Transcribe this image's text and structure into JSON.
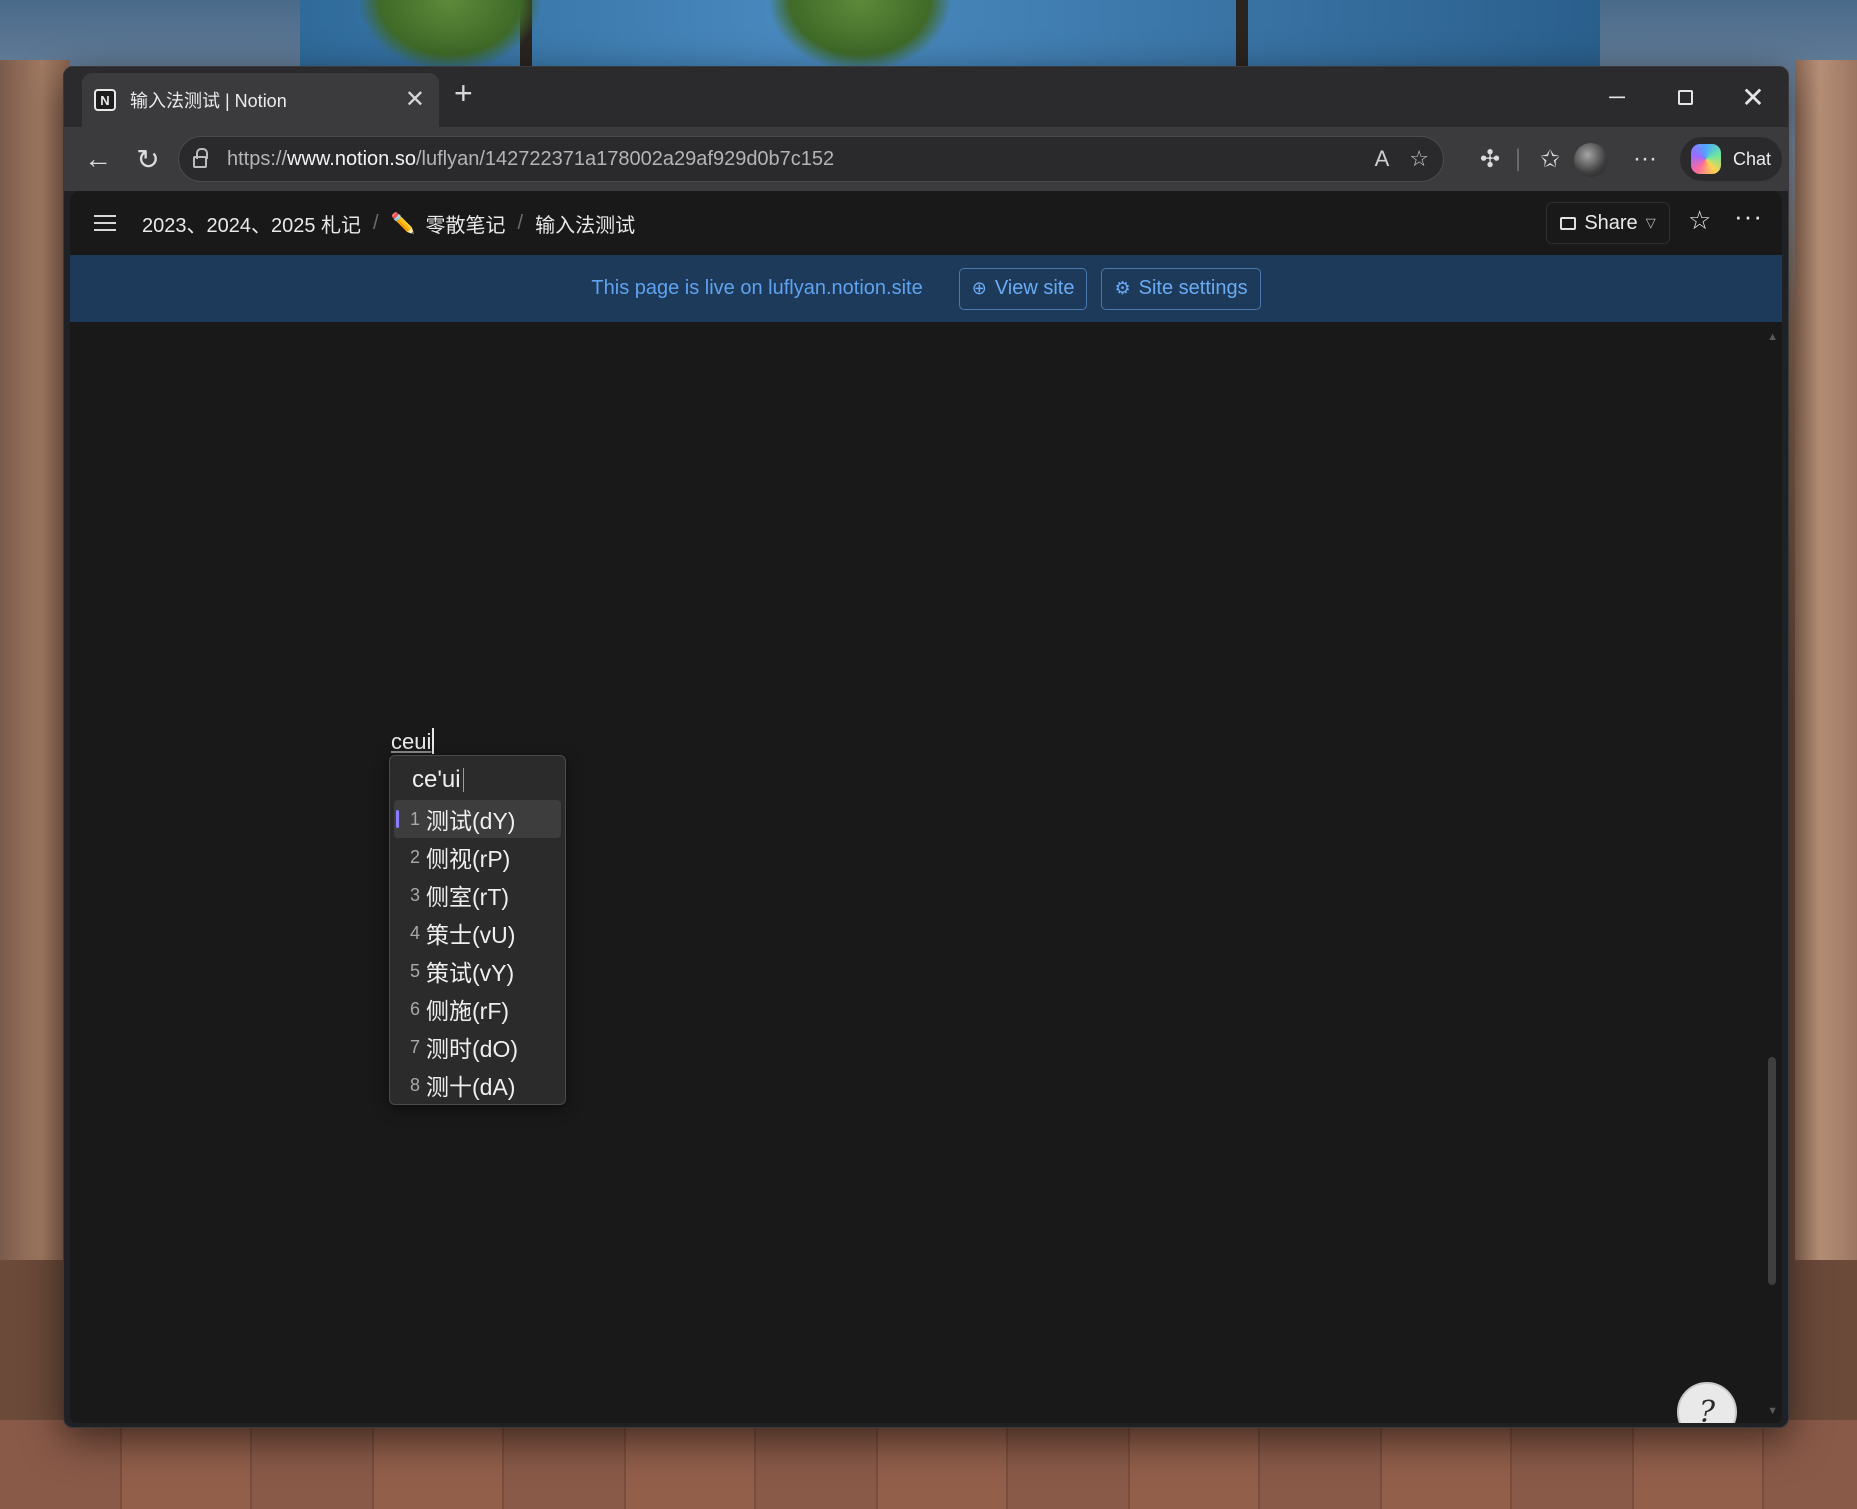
{
  "browser": {
    "tab_title": "输入法测试 | Notion",
    "tab_favicon": "N",
    "new_tab": "+",
    "url_prefix": "https://",
    "url_host": "www.notion.so",
    "url_path": "/luflyan/142722371a178002a29af929d0b7c152",
    "read_aloud": "A",
    "chat_label": "Chat"
  },
  "notion": {
    "breadcrumb": [
      "2023、2024、2025 札记",
      "零散笔记",
      "输入法测试"
    ],
    "breadcrumb_separator": "/",
    "pencil_emoji": "✏️",
    "share_label": "Share",
    "banner_text": "This page is live on luflyan.notion.site",
    "view_site_label": "View site",
    "site_settings_label": "Site settings",
    "typed_text": "ceui"
  },
  "ime": {
    "composition": "ce'ui",
    "candidates": [
      {
        "num": "1",
        "word": "测试(dY)"
      },
      {
        "num": "2",
        "word": "侧视(rP)"
      },
      {
        "num": "3",
        "word": "侧室(rT)"
      },
      {
        "num": "4",
        "word": "策士(vU)"
      },
      {
        "num": "5",
        "word": "策试(vY)"
      },
      {
        "num": "6",
        "word": "侧施(rF)"
      },
      {
        "num": "7",
        "word": "测时(dO)"
      },
      {
        "num": "8",
        "word": "测十(dA)"
      }
    ],
    "selected_index": 0
  },
  "colors": {
    "page_bg": "#191919",
    "banner_bg": "#1d3a5a",
    "banner_accent": "#5fa3f0",
    "ime_highlight": "#8a7dff"
  },
  "icons": {
    "back": "back-arrow-icon",
    "reload": "reload-icon",
    "lock": "lock-icon",
    "favorite": "star-icon",
    "extensions": "puzzle-icon",
    "favorites": "favorites-icon",
    "menu": "hamburger-icon",
    "help": "help-icon"
  }
}
